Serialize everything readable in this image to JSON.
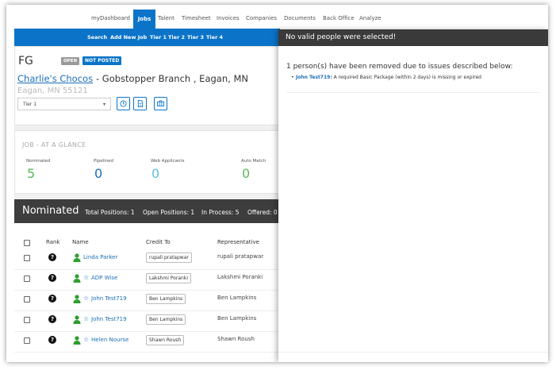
{
  "topnav": {
    "items": [
      "myDashboard",
      "Jobs",
      "Talent",
      "Timesheet",
      "Invoices",
      "Companies",
      "Documents",
      "Back Office",
      "Analyze"
    ]
  },
  "subnav": {
    "items": [
      "Search",
      "Add New Job",
      "Tier 1",
      "Tier 2",
      "Tier 3",
      "Tier 4"
    ]
  },
  "job": {
    "code": "FG",
    "badge_open": "OPEN",
    "badge_not_posted": "NOT POSTED",
    "company": "Charlie's Chocos",
    "branch": "- Gobstopper Branch , Eagan, MN",
    "address": "Eagan, MN 55121",
    "tier_select": "Tier 1"
  },
  "glance": {
    "title": "JOB - AT A GLANCE",
    "stats": [
      {
        "label": "Nominated",
        "value": "5",
        "color": "#5cb85c"
      },
      {
        "label": "Pipelined",
        "value": "0",
        "color": "#1c6fb8"
      },
      {
        "label": "Web Applicants",
        "value": "0",
        "color": "#5bc0de"
      },
      {
        "label": "Auto Match",
        "value": "0",
        "color": "#5cb85c"
      }
    ]
  },
  "nominated": {
    "title": "Nominated",
    "total_positions": "Total Positions: 1",
    "open_positions": "Open Positions: 1",
    "in_process": "In Process: 5",
    "offered": "Offered: 0"
  },
  "table": {
    "headers": [
      "Rank",
      "Name",
      "Credit To",
      "Representative"
    ],
    "rows": [
      {
        "rank": "?",
        "starred": false,
        "name": "Linda Parker",
        "credit": "rupali pratapwar",
        "rep": "rupali pratapwar"
      },
      {
        "rank": "?",
        "starred": true,
        "name": "ADP Wise",
        "credit": "Lakshmi Poranki",
        "rep": "Lakshmi Poranki"
      },
      {
        "rank": "?",
        "starred": true,
        "name": "John Test719",
        "credit": "Ben Lampkins",
        "rep": "Ben Lampkins"
      },
      {
        "rank": "?",
        "starred": true,
        "name": "John Test719",
        "credit": "Ben Lampkins",
        "rep": "Ben Lampkins"
      },
      {
        "rank": "?",
        "starred": true,
        "name": "Helen Nourse",
        "credit": "Shawn Roush",
        "rep": "Shawn Roush"
      }
    ]
  },
  "overlay": {
    "title": "No valid people were selected!",
    "message": "1 person(s) have been removed due to issues described below:",
    "issues": [
      {
        "person": "John Test719:",
        "text": " A required Basic Package (within 2 days) is missing or expired"
      }
    ]
  },
  "colors": {
    "brand_blue": "#0b74c9",
    "header_dark": "#3a3a3a",
    "link_blue": "#1c6fb8",
    "person_green": "#2e9e2e"
  }
}
